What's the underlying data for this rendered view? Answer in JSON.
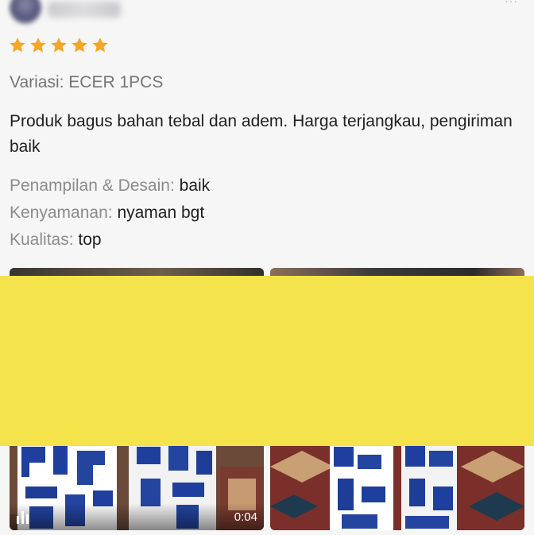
{
  "review": {
    "rating": 5,
    "variant": "Variasi: ECER 1PCS",
    "comment": "Produk bagus bahan tebal dan adem. Harga terjangkau, pengiriman baik",
    "attributes": [
      {
        "label": "Penampilan & Desain:",
        "value": "baik"
      },
      {
        "label": "Kenyamanan:",
        "value": "nyaman bgt"
      },
      {
        "label": "Kualitas:",
        "value": "top"
      }
    ]
  },
  "media": {
    "video_duration": "0:04"
  },
  "colors": {
    "star": "#F5A623",
    "redaction": "#F4E34B"
  }
}
